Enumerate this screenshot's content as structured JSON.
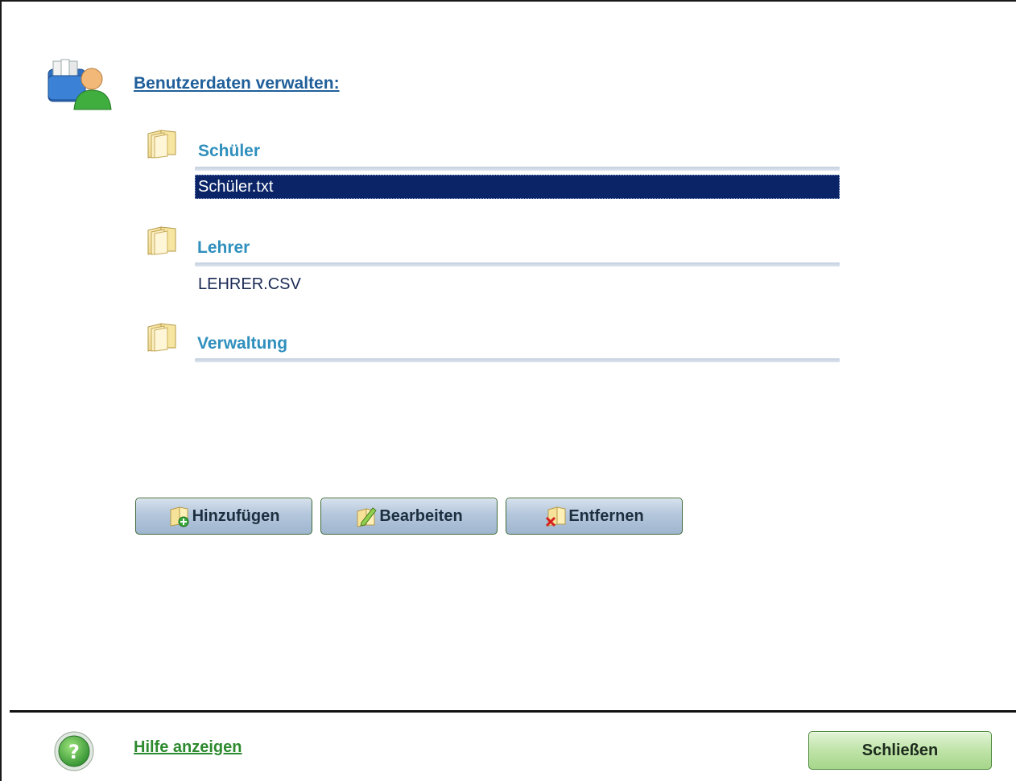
{
  "header": {
    "title": "Benutzerdaten verwalten:",
    "icon": "user-data-manage-icon"
  },
  "sections": [
    {
      "label": "Schüler",
      "icon": "folder-icon",
      "files": [
        {
          "name": "Schüler.txt",
          "selected": true
        }
      ]
    },
    {
      "label": "Lehrer",
      "icon": "folder-icon",
      "files": [
        {
          "name": "LEHRER.CSV",
          "selected": false
        }
      ]
    },
    {
      "label": "Verwaltung",
      "icon": "folder-icon",
      "files": []
    }
  ],
  "actions": {
    "add": {
      "label": "Hinzufügen",
      "icon": "folder-add-icon"
    },
    "edit": {
      "label": "Bearbeiten",
      "icon": "folder-edit-icon"
    },
    "remove": {
      "label": "Entfernen",
      "icon": "folder-remove-icon"
    }
  },
  "footer": {
    "help_label": "Hilfe anzeigen",
    "help_icon": "help-icon",
    "close_label": "Schließen"
  },
  "colors": {
    "title_link": "#1f5f9a",
    "section_title": "#2f8fbd",
    "selection_bg": "#0a2467",
    "help_link": "#2e8a2e"
  }
}
